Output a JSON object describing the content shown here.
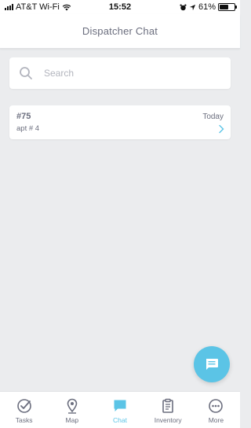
{
  "status_bar": {
    "carrier": "AT&T Wi-Fi",
    "time": "15:52",
    "battery": "61%",
    "battery_level": 0.61
  },
  "header": {
    "title": "Dispatcher Chat"
  },
  "search": {
    "placeholder": "Search",
    "value": ""
  },
  "chats": [
    {
      "title": "#75",
      "date": "Today",
      "subtitle": "apt # 4"
    }
  ],
  "fab": {
    "icon": "chat-bubble-icon"
  },
  "nav": {
    "items": [
      {
        "label": "Tasks",
        "icon": "check-circle-icon",
        "active": false
      },
      {
        "label": "Map",
        "icon": "map-pin-icon",
        "active": false
      },
      {
        "label": "Chat",
        "icon": "chat-bubble-icon",
        "active": true
      },
      {
        "label": "Inventory",
        "icon": "clipboard-icon",
        "active": false
      },
      {
        "label": "More",
        "icon": "more-dots-icon",
        "active": false
      }
    ]
  },
  "colors": {
    "accent": "#5bc4e6",
    "text": "#6b6e7e",
    "background": "#ebecee"
  }
}
